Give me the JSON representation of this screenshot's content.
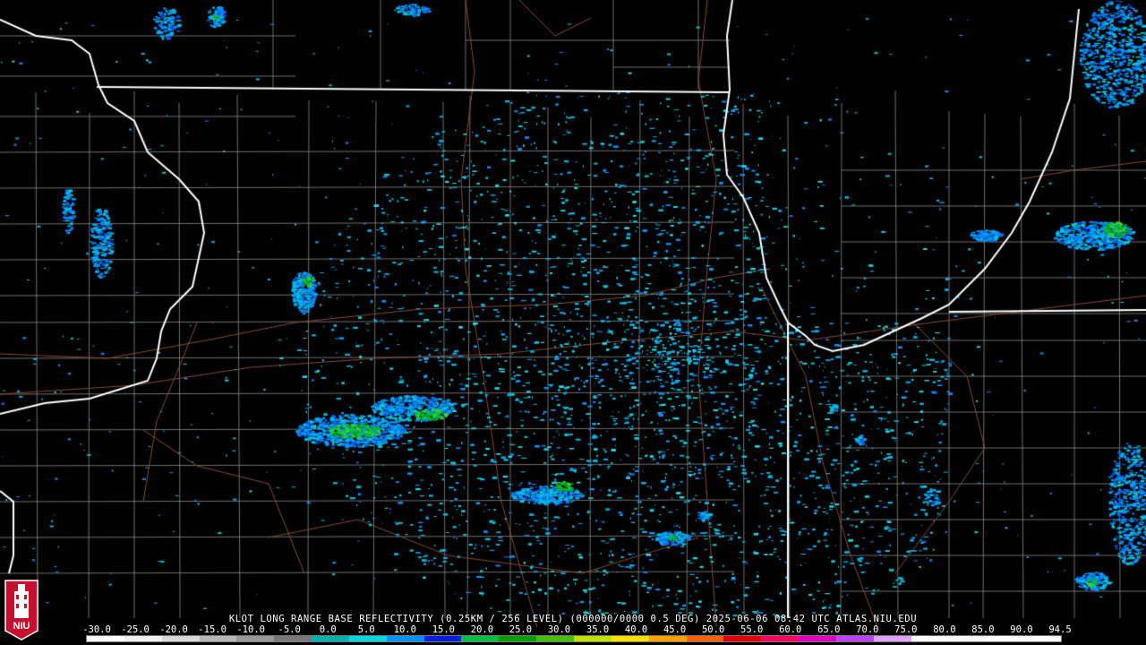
{
  "caption": "KLOT LONG RANGE BASE REFLECTIVITY (0.25KM / 256 LEVEL) (000000/0000 0.5 DEG) 2025-06-06 08:42 UTC  ATLAS.NIU.EDU",
  "logo": {
    "text": "NIU",
    "icon": "niu-tower-logo-icon"
  },
  "colors": {
    "background": "#000000",
    "state_border": "#ffffff",
    "county_border": "#8c8c8c",
    "highway": "#8a4a2c"
  },
  "scale": {
    "labels": [
      "-30.0",
      "-25.0",
      "-20.0",
      "-15.0",
      "-10.0",
      "-5.0",
      "0.0",
      "5.0",
      "10.0",
      "15.0",
      "20.0",
      "25.0",
      "30.0",
      "35.0",
      "40.0",
      "45.0",
      "50.0",
      "55.0",
      "60.0",
      "65.0",
      "70.0",
      "75.0",
      "80.0",
      "85.0",
      "90.0",
      "94.5"
    ],
    "colors": [
      "#ffffff",
      "#f0f0f0",
      "#d8d8d8",
      "#b8b8b8",
      "#989898",
      "#787878",
      "#00b0b0",
      "#00d8e0",
      "#0090ff",
      "#0020e0",
      "#00c040",
      "#00a000",
      "#40c000",
      "#c0e000",
      "#ffe000",
      "#ffa000",
      "#ff6000",
      "#e00000",
      "#ff0060",
      "#e000c0",
      "#c040ff",
      "#e0a0ff",
      "#ffffff",
      "#f8f8f8",
      "#ffffff",
      "#ffffff"
    ]
  }
}
